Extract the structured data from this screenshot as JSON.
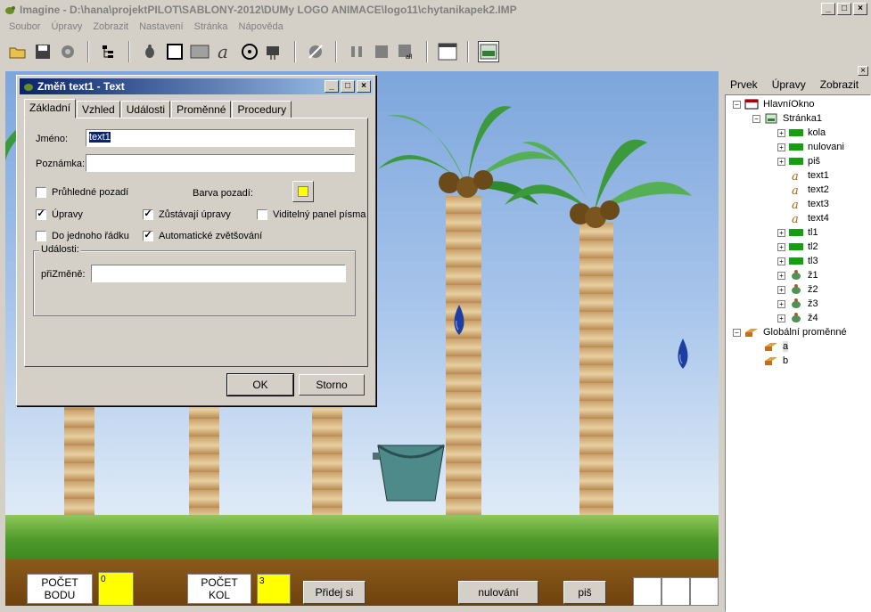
{
  "window": {
    "title": "Imagine - D:\\hana\\projektPILOT\\SABLONY-2012\\DUMy LOGO ANIMACE\\logo11\\chytanikapek2.IMP",
    "min": "_",
    "max": "□",
    "close": "×"
  },
  "menu": [
    "Soubor",
    "Úpravy",
    "Zobrazit",
    "Nastavení",
    "Stránka",
    "Nápověda"
  ],
  "toolbar": [
    "open-icon",
    "save-icon",
    "print-icon",
    "tree-icon",
    "turtle-icon",
    "box-icon",
    "rect-icon",
    "text-icon",
    "media-icon",
    "tools-icon",
    "run-icon",
    "pause-icon",
    "stop-icon",
    "stop-all-icon",
    "window-icon",
    "panel-icon"
  ],
  "dialog": {
    "title": "Změň text1  - Text",
    "tabs": [
      "Základní",
      "Vzhled",
      "Události",
      "Proměnné",
      "Procedury"
    ],
    "name_label": "Jméno:",
    "name_value": "text1",
    "note_label": "Poznámka:",
    "note_value": "",
    "transparent_label": "Průhledné pozadí",
    "bgcolor_label": "Barva pozadí:",
    "edit_label": "Úpravy",
    "keep_edit_label": "Zůstávají úpravy",
    "font_panel_label": "Viditelný panel písma",
    "single_line_label": "Do jednoho řádku",
    "auto_grow_label": "Automatické zvětšování",
    "events_group": "Události:",
    "onchange_label": "přiZměně:",
    "onchange_value": "",
    "ok": "OK",
    "cancel": "Storno",
    "checks": {
      "transparent": false,
      "edit": true,
      "keep_edit": true,
      "font_panel": false,
      "single_line": false,
      "auto_grow": true
    },
    "bgcolor": "#ffff00"
  },
  "page": {
    "score_label": "POČET\nBODU",
    "score_value": "0",
    "rounds_label": "POČET\nKOL",
    "rounds_value": "3",
    "add_round": "Přidej si kolo",
    "reset": "nulování",
    "write": "piš"
  },
  "rightpanel": {
    "menu": [
      "Prvek",
      "Úpravy",
      "Zobrazit"
    ],
    "close": "×",
    "tree": [
      {
        "label": "HlavníOkno",
        "level": 0,
        "pm": "−",
        "icon": "window-icon"
      },
      {
        "label": "Stránka1",
        "level": 1,
        "pm": "−",
        "icon": "page-icon"
      },
      {
        "label": "kola",
        "level": 2,
        "pm": "+",
        "icon": "green-button-icon"
      },
      {
        "label": "nulovani",
        "level": 2,
        "pm": "+",
        "icon": "green-button-icon"
      },
      {
        "label": "piš",
        "level": 2,
        "pm": "+",
        "icon": "green-button-icon"
      },
      {
        "label": "text1",
        "level": 2,
        "pm": "",
        "icon": "text-icon"
      },
      {
        "label": "text2",
        "level": 2,
        "pm": "",
        "icon": "text-icon"
      },
      {
        "label": "text3",
        "level": 2,
        "pm": "",
        "icon": "text-icon"
      },
      {
        "label": "text4",
        "level": 2,
        "pm": "",
        "icon": "text-icon"
      },
      {
        "label": "tl1",
        "level": 2,
        "pm": "+",
        "icon": "green-button-icon"
      },
      {
        "label": "tl2",
        "level": 2,
        "pm": "+",
        "icon": "green-button-icon"
      },
      {
        "label": "tl3",
        "level": 2,
        "pm": "+",
        "icon": "green-button-icon"
      },
      {
        "label": "ž1",
        "level": 2,
        "pm": "+",
        "icon": "turtle-icon"
      },
      {
        "label": "ž2",
        "level": 2,
        "pm": "+",
        "icon": "turtle-icon"
      },
      {
        "label": "ž3",
        "level": 2,
        "pm": "+",
        "icon": "turtle-icon"
      },
      {
        "label": "ž4",
        "level": 2,
        "pm": "+",
        "icon": "turtle-icon"
      },
      {
        "label": "Globální proměnné",
        "level": 0,
        "pm": "−",
        "icon": "variables-icon"
      },
      {
        "label": "a",
        "level": 1,
        "pm": "",
        "icon": "variable-icon"
      },
      {
        "label": "b",
        "level": 1,
        "pm": "",
        "icon": "variable-icon"
      }
    ]
  }
}
